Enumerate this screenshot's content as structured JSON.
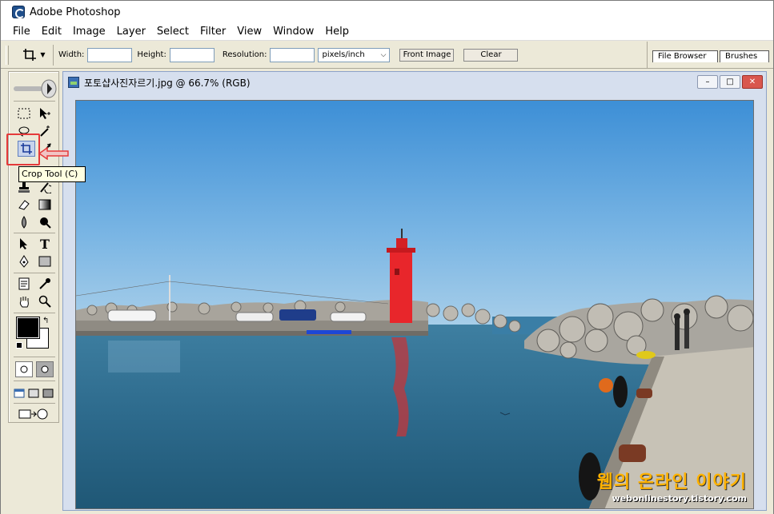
{
  "titlebar": {
    "title": "Adobe Photoshop"
  },
  "menu": [
    "File",
    "Edit",
    "Image",
    "Layer",
    "Select",
    "Filter",
    "View",
    "Window",
    "Help"
  ],
  "options": {
    "width_label": "Width:",
    "height_label": "Height:",
    "resolution_label": "Resolution:",
    "units_value": "pixels/inch",
    "front_image_label": "Front Image",
    "clear_label": "Clear",
    "width_value": "",
    "height_value": "",
    "resolution_value": ""
  },
  "palette_well": {
    "tabs": [
      "File Browser",
      "Brushes"
    ]
  },
  "document": {
    "title": "포토샵사진자르기.jpg @ 66.7% (RGB)",
    "minimize": "–",
    "maximize": "□",
    "close": "✕"
  },
  "tooltip": {
    "text": "Crop Tool (C)"
  },
  "watermark": {
    "korean": "웹의 온라인 이야기",
    "url": "webonlinestory.tistory.com"
  },
  "colors": {
    "highlight_red": "#e53a3a",
    "sky": "#5a9fd8",
    "sea": "#2f6f8e",
    "lighthouse": "#e8262b"
  }
}
